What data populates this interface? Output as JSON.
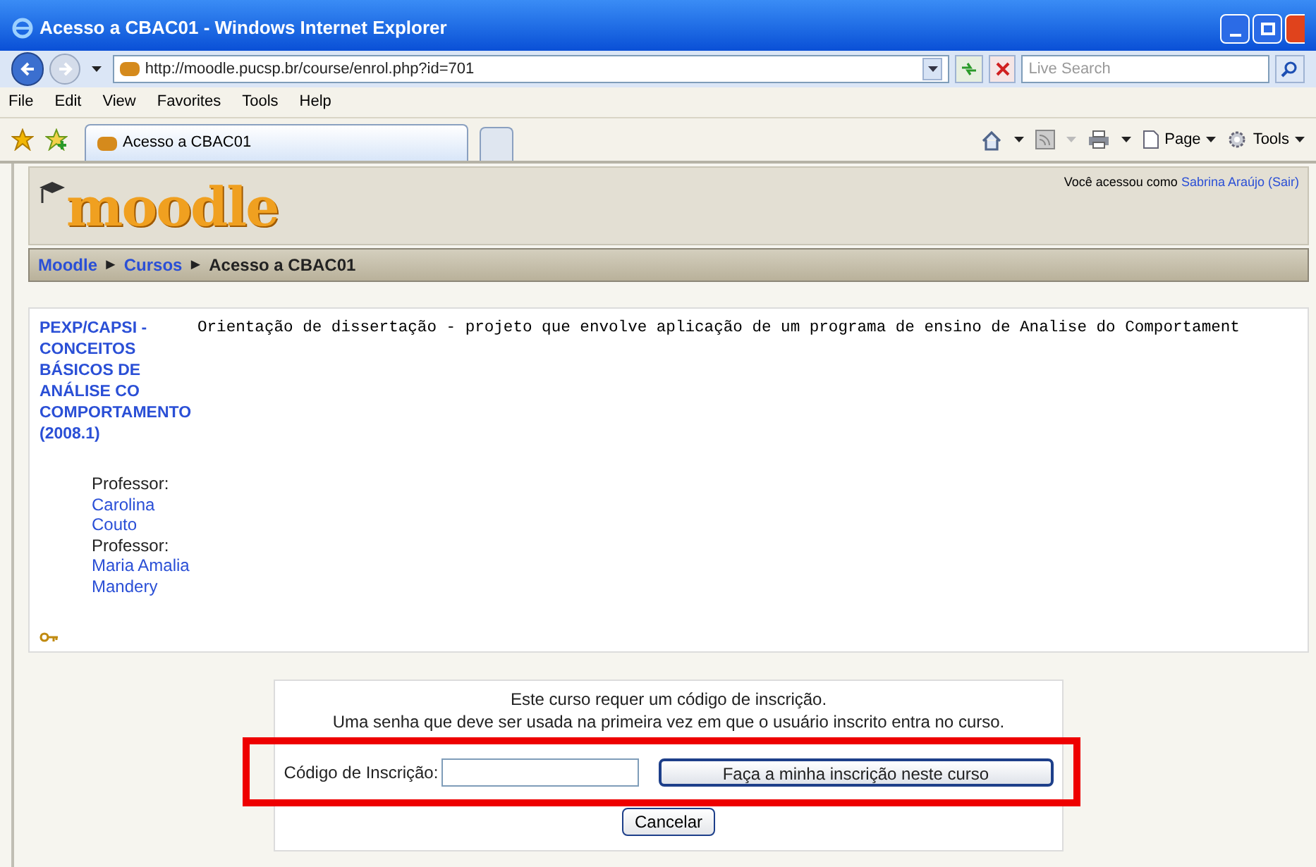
{
  "window": {
    "title": "Acesso a CBAC01 - Windows Internet Explorer"
  },
  "address_bar": {
    "url": "http://moodle.pucsp.br/course/enrol.php?id=701"
  },
  "search": {
    "placeholder": "Live Search"
  },
  "menu": [
    "File",
    "Edit",
    "View",
    "Favorites",
    "Tools",
    "Help"
  ],
  "tabs": [
    {
      "label": "Acesso a CBAC01",
      "selected": true
    }
  ],
  "toolbar": [
    "Page",
    "Tools"
  ],
  "page": {
    "logo": "moodle",
    "login_info": {
      "prefix": "Você acessou como",
      "user": "Sabrina Araújo",
      "logout": "(Sair)"
    },
    "breadcrumb": [
      {
        "label": "Moodle",
        "link": true,
        "separator": "►"
      },
      {
        "label": "Cursos",
        "link": true,
        "separator": "►"
      },
      {
        "label": "Acesso a CBAC01",
        "link": false
      }
    ],
    "course": {
      "name": "PEXP/CAPSI - CONCEITOS BÁSICOS DE ANÁLISE CO COMPORTAMENTO (2008.1)",
      "summary": "Orientação de dissertação - projeto que envolve aplicação de um programa de ensino de Analise do Comportament",
      "teachers": [
        {
          "role": "Professor:",
          "name": "Carolina Couto"
        },
        {
          "role": "Professor:",
          "name": "Maria Amalia Mandery"
        }
      ]
    },
    "enrol": {
      "message": [
        "Este curso requer um código de inscrição.",
        "Uma senha que deve ser usada na primeira vez em que o usuário inscrito entra no curso."
      ],
      "field_label": "Código de Inscrição:",
      "submit": "Faça a minha inscrição neste curso",
      "cancel": "Cancelar"
    }
  }
}
